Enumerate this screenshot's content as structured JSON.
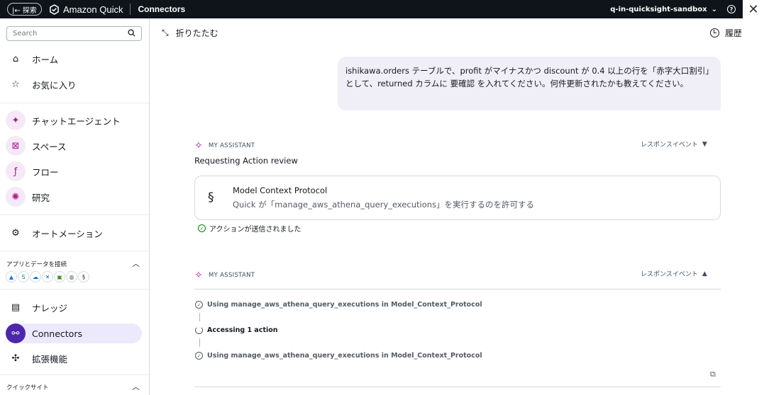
{
  "topbar": {
    "back_label": "|← 探索",
    "brand": "Amazon Quick",
    "page": "Connectors",
    "account": "q-in-quicksight-sandbox",
    "help": "?"
  },
  "sidebar": {
    "search_placeholder": "Search",
    "items": [
      {
        "label": "ホーム",
        "icon": "home-icon"
      },
      {
        "label": "お気に入り",
        "icon": "star-icon"
      },
      {
        "label": "チャットエージェント",
        "icon": "chat-agent-icon"
      },
      {
        "label": "スペース",
        "icon": "spaces-icon"
      },
      {
        "label": "フロー",
        "icon": "flows-icon"
      },
      {
        "label": "研究",
        "icon": "research-icon"
      },
      {
        "label": "オートメーション",
        "icon": "automation-icon"
      },
      {
        "label": "ナレッジ",
        "icon": "knowledge-icon"
      },
      {
        "label": "Connectors",
        "icon": "connectors-icon"
      },
      {
        "label": "拡張機能",
        "icon": "extensions-icon"
      }
    ],
    "apps_section": "アプリとデータを接続",
    "quicksight_section": "クイックサイト"
  },
  "main": {
    "collapse_label": "折りたたむ",
    "history_label": "履歴",
    "user_message": "ishikawa.orders テーブルで、profit がマイナスかつ discount が 0.4 以上の行を「赤字大口割引」として、returned カラムに 要確認 を入れてください。何件更新されたかも教えてください。",
    "assistant_label": "MY ASSISTANT",
    "response_events": "レスポンスイベント",
    "requesting_title": "Requesting Action review",
    "card_title": "Model Context Protocol",
    "card_desc": "Quick が「manage_aws_athena_query_executions」を実行するのを許可する",
    "sent_text": "アクションが送信されました",
    "steps": [
      "Using manage_aws_athena_query_executions in Model_Context_Protocol",
      "Accessing 1 action",
      "Using manage_aws_athena_query_executions in Model_Context_Protocol"
    ]
  }
}
